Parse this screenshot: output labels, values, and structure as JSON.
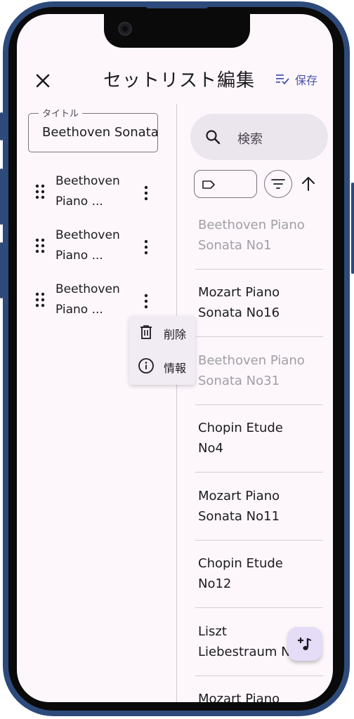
{
  "header": {
    "title": "セットリスト編集",
    "save_label": "保存",
    "close_icon": "close-icon",
    "save_icon": "playlist-check-icon"
  },
  "setlist": {
    "title_label": "タイトル",
    "title_value": "Beethoven Sonata",
    "items": [
      {
        "label": "Beethoven Piano ..."
      },
      {
        "label": "Beethoven Piano ..."
      },
      {
        "label": "Beethoven Piano ..."
      }
    ]
  },
  "context_menu": {
    "delete_label": "削除",
    "info_label": "情報"
  },
  "library": {
    "search_placeholder": "検索",
    "songs": [
      {
        "line1": "Beethoven Piano",
        "line2": "Sonata No1",
        "dimmed": true
      },
      {
        "line1": "Mozart Piano",
        "line2": "Sonata No16",
        "dimmed": false
      },
      {
        "line1": "Beethoven Piano",
        "line2": "Sonata No31",
        "dimmed": true
      },
      {
        "line1": "Chopin Etude",
        "line2": "No4",
        "dimmed": false
      },
      {
        "line1": "Mozart Piano",
        "line2": "Sonata No11",
        "dimmed": false
      },
      {
        "line1": "Chopin Etude",
        "line2": "No12",
        "dimmed": false
      },
      {
        "line1": "Liszt",
        "line2": "Liebestraum No3",
        "dimmed": false
      },
      {
        "line1": "Mozart Piano",
        "line2": "",
        "dimmed": false
      }
    ]
  },
  "colors": {
    "accent": "#4a53a8",
    "background": "#fdf7fc",
    "fab": "#e5dcf8",
    "dimmed_text": "#a09ea4",
    "device_frame": "#2d4a7a"
  }
}
